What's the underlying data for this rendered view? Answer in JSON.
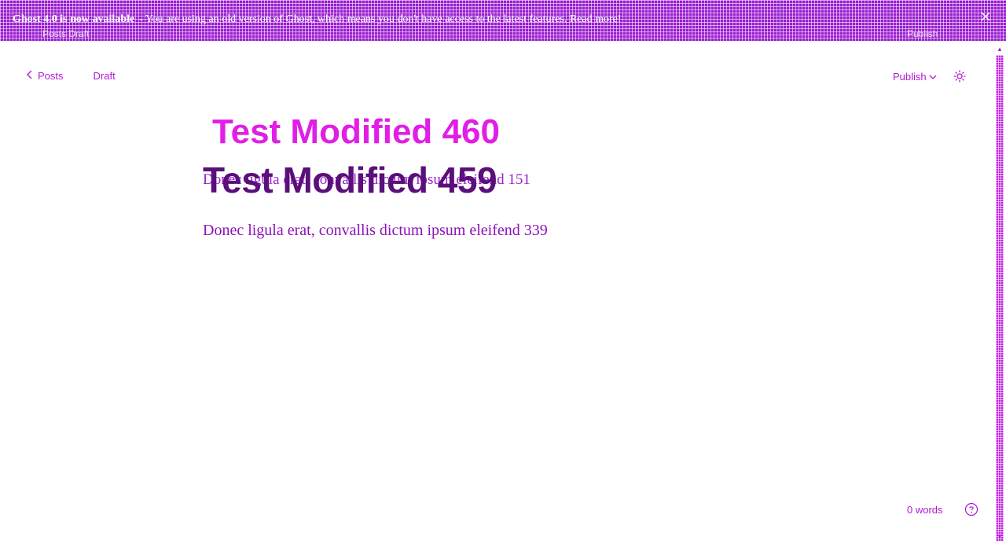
{
  "banner": {
    "bold_text": "Ghost 4.0 is now available",
    "message": "- You are using an old version of Ghost, which means you don't have access to the latest features. Read more!",
    "close_icon": "close-icon",
    "ghost_left": "Posts  Draft",
    "ghost_right": "Publish"
  },
  "nav": {
    "back_label": "Posts",
    "back_icon": "chevron-left-icon",
    "status": "Draft"
  },
  "toolbar": {
    "publish_label": "Publish",
    "publish_icon": "chevron-down-icon",
    "settings_icon": "gear-icon"
  },
  "editor": {
    "title_ghost": "Test Modified 460",
    "title": "Test Modified 459",
    "paragraph_ghost": "Donec ligula erat, convallis dictum ipsum eleifend 151",
    "paragraph": "Donec ligula erat, convallis dictum ipsum eleifend 339"
  },
  "footer": {
    "word_count": "0 words",
    "help_icon": "help-icon"
  },
  "colors": {
    "accent": "#b219d6",
    "banner": "#9a1ed0",
    "title_dark": "#5a0f7a",
    "title_light": "#e21ee6"
  }
}
